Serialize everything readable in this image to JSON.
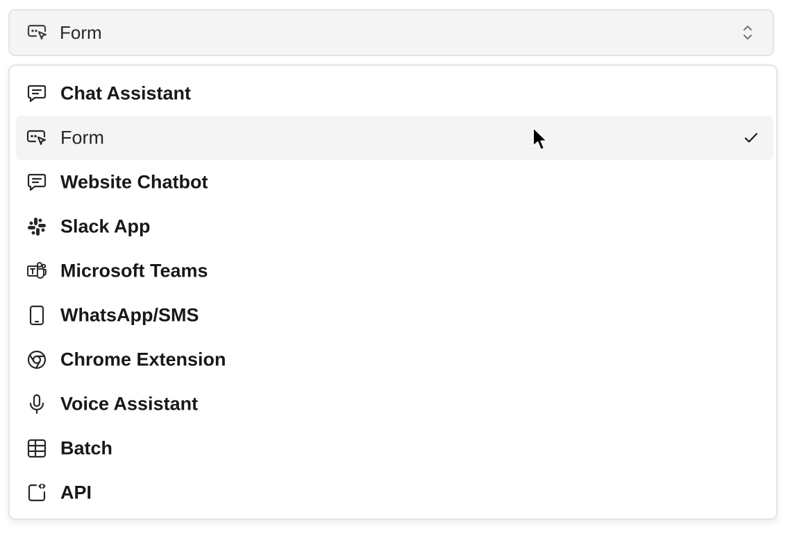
{
  "select": {
    "selected_label": "Form",
    "selected_icon": "form-cursor-icon"
  },
  "menu": {
    "items": [
      {
        "label": "Chat Assistant",
        "icon": "chat-bubble-icon",
        "selected": false
      },
      {
        "label": "Form",
        "icon": "form-cursor-icon",
        "selected": true
      },
      {
        "label": "Website Chatbot",
        "icon": "chat-bubble-icon",
        "selected": false
      },
      {
        "label": "Slack App",
        "icon": "slack-icon",
        "selected": false
      },
      {
        "label": "Microsoft Teams",
        "icon": "teams-icon",
        "selected": false
      },
      {
        "label": "WhatsApp/SMS",
        "icon": "phone-icon",
        "selected": false
      },
      {
        "label": "Chrome Extension",
        "icon": "chrome-icon",
        "selected": false
      },
      {
        "label": "Voice Assistant",
        "icon": "microphone-icon",
        "selected": false
      },
      {
        "label": "Batch",
        "icon": "table-grid-icon",
        "selected": false
      },
      {
        "label": "API",
        "icon": "code-square-icon",
        "selected": false
      }
    ]
  },
  "colors": {
    "trigger_bg": "#f4f4f5",
    "border": "#e4e4e7",
    "selected_bg": "#f4f4f5",
    "text": "#18181b",
    "icon_stroke": "#27272a"
  }
}
